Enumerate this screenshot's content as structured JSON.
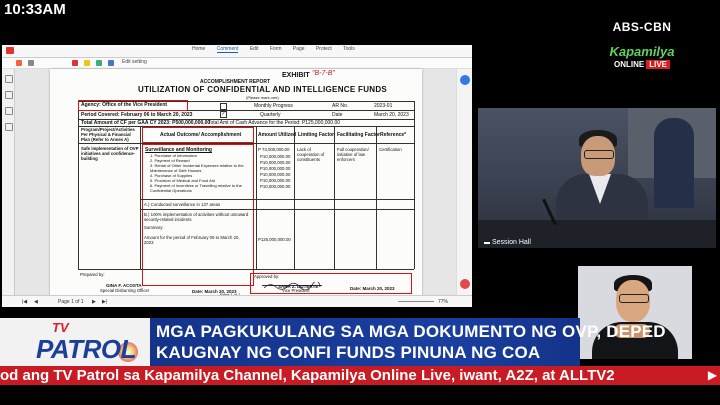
{
  "clock": "10:33AM",
  "network": {
    "abscbn": "ABS-CBN",
    "kapamilya": "Kapamilya",
    "online": "ONLINE",
    "live": "LIVE"
  },
  "pdf_viewer": {
    "menu": [
      "Home",
      "Comment",
      "Edit",
      "Form",
      "Page",
      "Protect",
      "Tools"
    ],
    "active_menu": "Comment",
    "edit_label": "Edit setting",
    "page_indicator": "Page 1 of 1",
    "zoom": "77%"
  },
  "document": {
    "exhibit": "EXHIBIT",
    "exhibit_handwritten": "\"B-7-B\"",
    "report_type": "ACCOMPLISHMENT REPORT",
    "title": "UTILIZATION OF CONFIDENTIAL AND INTELLIGENCE FUNDS",
    "please_mark": "(Please mark one)",
    "agency_label": "Agency: Office of the Vice President",
    "period_label": "Period Covered: February 06 to March 20, 2023",
    "monthly": "Monthly Progress",
    "quarterly": "Quarterly",
    "ar_no_label": "AR No.",
    "ar_no": "2023-01",
    "date_label": "Date",
    "date_value": "March 20, 2023",
    "total_amount": "Total Amount of CF per GAA CY 2023: P500,000,000.00",
    "cash_advance": "Total Amt of Cash Advance for the Period: P125,000,000.00",
    "col_program": "Program/Project/Activities Per Physical & Financial Plan (Refer to Annex A)",
    "col_outcome": "Actual Outcome/ Accomplishment",
    "col_amount": "Amount Utilized",
    "col_limiting": "Limiting Factor",
    "col_facilitating": "Facilitating Factor",
    "col_reference": "Reference*",
    "program": "Safe implementation of OVP initiatives and confidence-building",
    "outcome_heading": "Surveillance and Monitoring",
    "outcome_items": [
      "1. Purchase of Information",
      "2. Payment of Reward",
      "3. Rental of Other Incidental Expenses relative to the Maintenance of Safe Houses",
      "4. Purchase of Supplies",
      "5. Provision of Medical and Food Aid",
      "6. Payment of Incentives or Travelling relative to the Confidential Operations"
    ],
    "amounts": [
      "P 73,000,000.00",
      "P10,000,000.00",
      "P10,000,000.00",
      "P10,000,000.00",
      "P10,000,000.00",
      "P10,000,000.00",
      "P10,000,000.00"
    ],
    "limiting": "Lack of cooperation of constituents",
    "facilitating": "Full cooperation/ initiative of law enforcers",
    "reference": "Certification",
    "surveillance": "A.) Conducted surveillance in 137 areas",
    "implementation": "B.) 100% implementation of activities without untoward security-related incidents",
    "summary": "Summary:",
    "amount_period": "Amount for the period of February 06 to March 20, 2023",
    "amount_total": "P125,000,000.00",
    "prepared_by": "Prepared by:",
    "officer_name": "GINA F. ACOSTA",
    "officer_title": "Special Disbursing Officer",
    "date_prepared": "Date: March 20, 2023",
    "approved_by": "Approved by:",
    "vp_name": "SARA Z. DUTERTE",
    "vp_title": "Vice President",
    "date_approved": "Date: March 20, 2023",
    "page_footer": "Page 1 of 1"
  },
  "video": {
    "location": "Session Hall"
  },
  "lower_third": {
    "logo_tv": "TV",
    "logo_patrol": "PATROL",
    "headline_line1": "MGA PAGKUKULANG SA MGA DOKUMENTO NG OVP, DEPED",
    "headline_line2": "KAUGNAY NG CONFI FUNDS PINUNA NG COA",
    "ticker": "od ang TV Patrol sa Kapamilya Channel, Kapamilya Online Live, iwant, A2Z, at ALLTV2",
    "ticker_arrow": "▶"
  },
  "colors": {
    "headline_blue": "#1a3fa0",
    "ticker_red": "#c81b23",
    "annotation_red": "#d11"
  }
}
